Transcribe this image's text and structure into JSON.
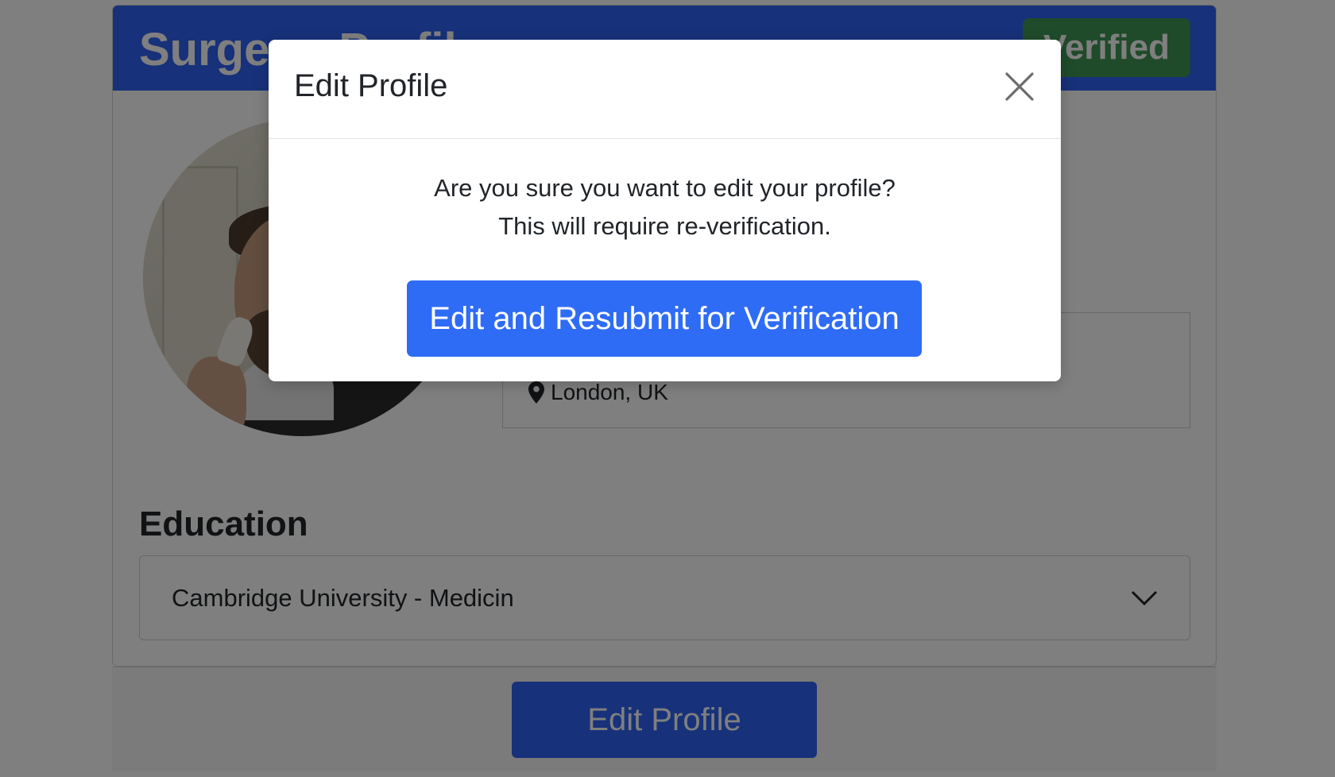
{
  "profile": {
    "title": "Surgeon Profile",
    "verified_badge": "Verified",
    "location": "London, UK",
    "education_heading": "Education",
    "education_selected": "Cambridge University - Medicin",
    "edit_button": "Edit Profile"
  },
  "modal": {
    "title": "Edit Profile",
    "message_line1": "Are you sure you want to edit your profile?",
    "message_line2": "This will require re-verification.",
    "confirm_button": "Edit and Resubmit for Verification"
  },
  "icons": {
    "close": "close-icon",
    "location": "map-marker-icon",
    "dropdown": "chevron-down-icon"
  },
  "colors": {
    "primary": "#2f62f4",
    "success": "#3f9657",
    "backdrop": "rgba(0,0,0,0.5)"
  }
}
